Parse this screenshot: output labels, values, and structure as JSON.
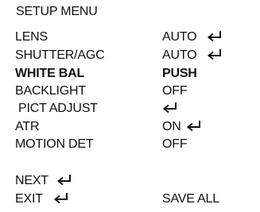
{
  "menu": {
    "title": "SETUP MENU",
    "items": [
      {
        "label": "LENS",
        "value": "AUTO"
      },
      {
        "label": "SHUTTER/AGC",
        "value": "AUTO"
      },
      {
        "label": "WHITE BAL",
        "value": "PUSH"
      },
      {
        "label": "BACKLIGHT",
        "value": "OFF"
      },
      {
        "label": "PICT ADJUST",
        "value": ""
      },
      {
        "label": "ATR",
        "value": "ON"
      },
      {
        "label": "MOTION DET",
        "value": "OFF"
      }
    ],
    "next_label": "NEXT",
    "exit_label": "EXIT",
    "save_all_label": "SAVE ALL",
    "highlighted_item": "WHITE BAL",
    "enter_icon": "enter-return-arrow-icon"
  },
  "colors": {
    "background": "#ffffff",
    "text": "#111111"
  }
}
